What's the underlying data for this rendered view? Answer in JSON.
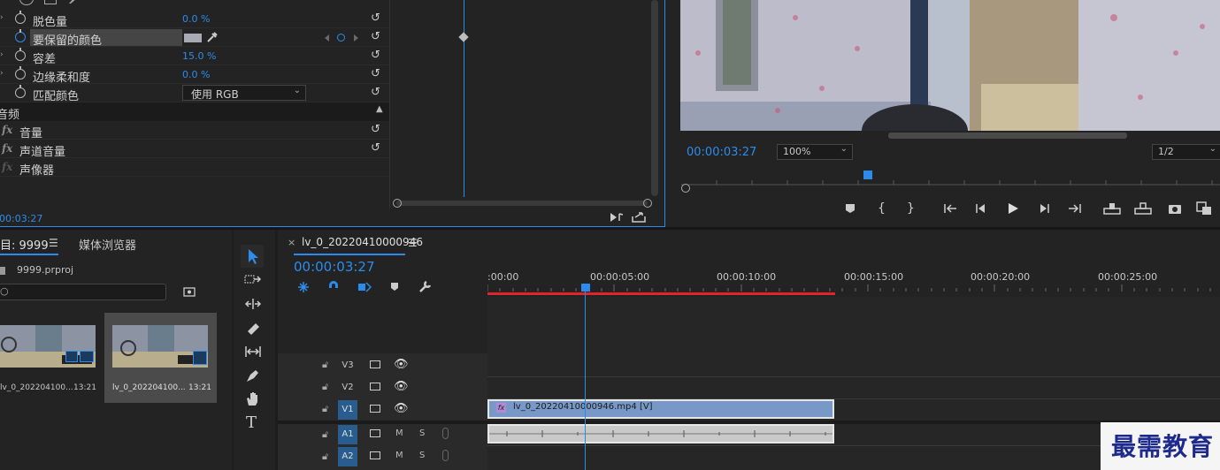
{
  "effects": {
    "rows": [
      {
        "name": "脱色量",
        "value": "0.0 %",
        "expand": true
      },
      {
        "name": "要保留的颜色",
        "value": "",
        "expand": false
      },
      {
        "name": "容差",
        "value": "15.0 %",
        "expand": true
      },
      {
        "name": "边缘柔和度",
        "value": "0.0 %",
        "expand": true
      },
      {
        "name": "匹配颜色",
        "value": "使用 RGB",
        "expand": false
      }
    ],
    "audio_section": "音频",
    "audio_rows": [
      "音量",
      "声道音量",
      "声像器"
    ],
    "fx_label": "fx",
    "reset_glyph": "↺",
    "timecode": "00:03:27"
  },
  "monitor": {
    "timecode": "00:00:03:27",
    "zoom": "100%",
    "resolution": "1/2"
  },
  "project": {
    "tab_project": "目: 9999",
    "tab_media": "媒体浏览器",
    "file": "9999.prproj",
    "clips": [
      {
        "name": "lv_0_202204100...",
        "duration": "13:21"
      },
      {
        "name": "lv_0_202204100...",
        "duration": "13:21"
      }
    ]
  },
  "timeline": {
    "tab_title": "lv_0_20220410000946",
    "timecode": "00:00:03:27",
    "ruler": [
      ":00:00",
      "00:00:05:00",
      "00:00:10:00",
      "00:00:15:00",
      "00:00:20:00",
      "00:00:25:00"
    ],
    "tracks": [
      {
        "id": "V3",
        "on": false
      },
      {
        "id": "V2",
        "on": false
      },
      {
        "id": "V1",
        "on": true
      },
      {
        "id": "A1",
        "on": true
      },
      {
        "id": "A2",
        "on": true
      }
    ],
    "m_label": "M",
    "s_label": "S",
    "video_clip": "lv_0_20220410000946.mp4 [V]",
    "clip_fx": "fx"
  },
  "watermark": "最需教育",
  "colors": {
    "accent": "#2d8ceb",
    "panel": "#232323",
    "clip_video": "#7899c7",
    "clip_audio": "#c9c9c9",
    "work_area": "#e0262b"
  }
}
